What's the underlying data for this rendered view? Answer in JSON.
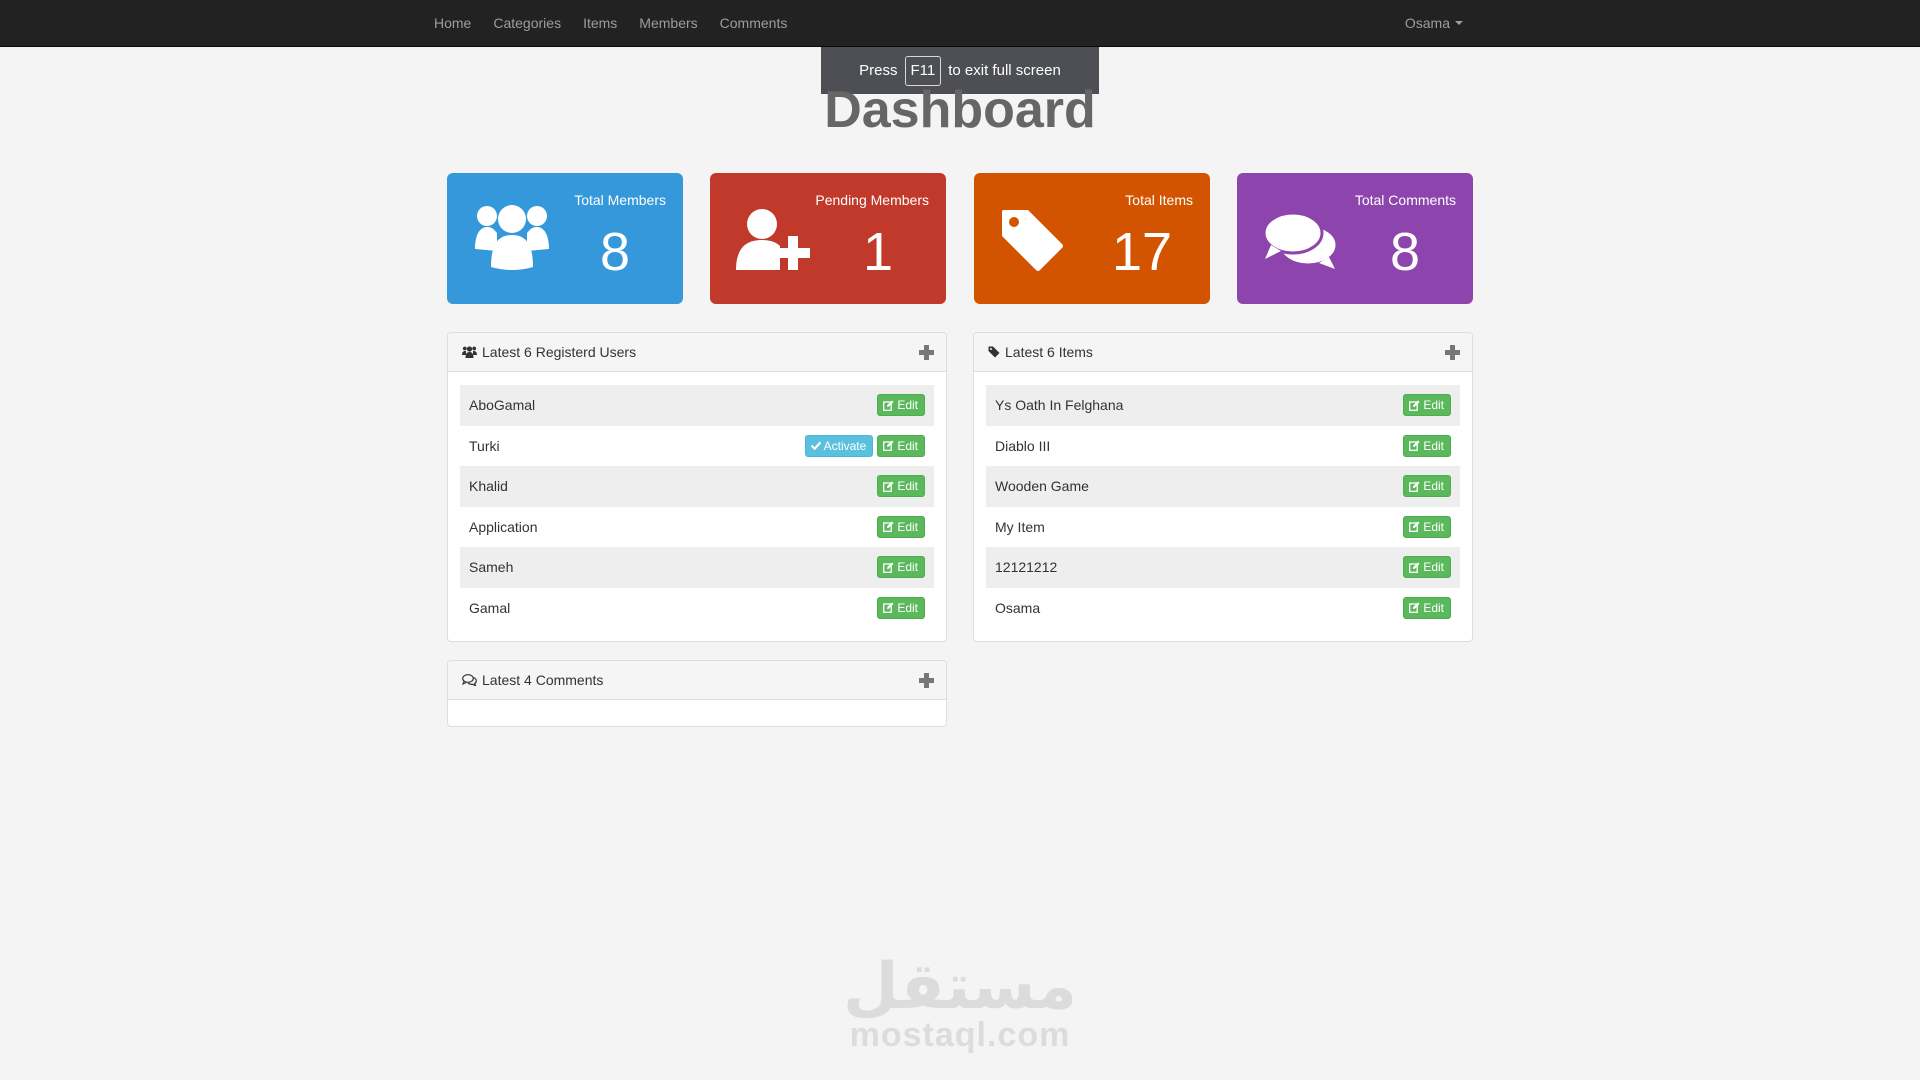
{
  "nav": {
    "links": [
      "Home",
      "Categories",
      "Items",
      "Members",
      "Comments"
    ],
    "user": "Osama"
  },
  "fullscreen_notice": {
    "before": "Press",
    "key": "F11",
    "after": "to exit full screen"
  },
  "page_title": "Dashboard",
  "stats": [
    {
      "label": "Total Members",
      "value": "8",
      "icon": "users-icon",
      "color": "#3498db"
    },
    {
      "label": "Pending Members",
      "value": "1",
      "icon": "user-plus-icon",
      "color": "#c0392b"
    },
    {
      "label": "Total Items",
      "value": "17",
      "icon": "tag-icon",
      "color": "#d35400"
    },
    {
      "label": "Total Comments",
      "value": "8",
      "icon": "comments-icon",
      "color": "#8e44ad"
    }
  ],
  "latest_users": {
    "title": "Latest 6 Registerd Users",
    "edit_label": "Edit",
    "activate_label": "Activate",
    "rows": [
      "AboGamal",
      "Turki",
      "Khalid",
      "Application",
      "Sameh",
      "Gamal"
    ]
  },
  "latest_items": {
    "title": "Latest 6 Items",
    "edit_label": "Edit",
    "rows": [
      "Ys Oath In Felghana",
      "Diablo III",
      "Wooden Game",
      "My Item",
      "12121212",
      "Osama"
    ]
  },
  "latest_comments": {
    "title": "Latest 4 Comments"
  },
  "watermark": {
    "arabic": "مستقل",
    "latin": "mostaql.com"
  }
}
